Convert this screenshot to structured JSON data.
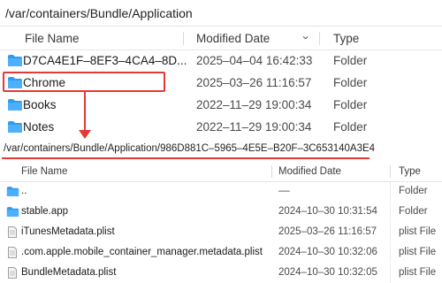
{
  "top": {
    "path": "/var/containers/Bundle/Application",
    "headers": {
      "name": "File Name",
      "date": "Modified Date",
      "kind": "Type"
    },
    "rows": [
      {
        "name": "D7CA4E1F–8EF3–4CA4–8D...",
        "date": "2025–04–04 16:42:33",
        "kind": "Folder",
        "icon": "folder-icon"
      },
      {
        "name": "Chrome",
        "date": "2025–03–26 11:16:57",
        "kind": "Folder",
        "icon": "folder-icon"
      },
      {
        "name": "Books",
        "date": "2022–11–29 19:00:34",
        "kind": "Folder",
        "icon": "folder-icon"
      },
      {
        "name": "Notes",
        "date": "2022–11–29 19:00:34",
        "kind": "Folder",
        "icon": "folder-icon"
      }
    ]
  },
  "bottom": {
    "path": "/var/containers/Bundle/Application/986D881C–5965–4E5E–B20F–3C653140A3E4",
    "headers": {
      "name": "File Name",
      "date": "Modified Date",
      "kind": "Type"
    },
    "rows": [
      {
        "name": "..",
        "date": "––",
        "kind": "Folder",
        "icon": "folder-icon"
      },
      {
        "name": "stable.app",
        "date": "2024–10–30 10:31:54",
        "kind": "Folder",
        "icon": "folder-icon"
      },
      {
        "name": "iTunesMetadata.plist",
        "date": "2025–03–26 11:16:57",
        "kind": "plist File",
        "icon": "document-icon"
      },
      {
        "name": ".com.apple.mobile_container_manager.metadata.plist",
        "date": "2024–10–30 10:32:06",
        "kind": "plist File",
        "icon": "document-icon"
      },
      {
        "name": "BundleMetadata.plist",
        "date": "2024–10–30 10:32:05",
        "kind": "plist File",
        "icon": "document-icon"
      }
    ]
  },
  "colors": {
    "folder": "#2f9cf0",
    "highlight": "#e53935"
  }
}
